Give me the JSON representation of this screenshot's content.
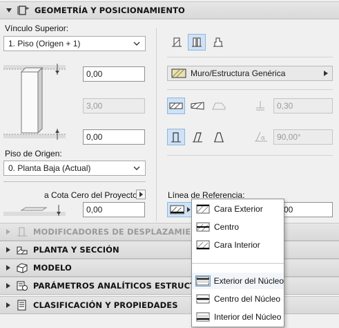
{
  "geometry": {
    "title": "GEOMETRÍA Y POSICIONAMIENTO",
    "top_link_label": "Vínculo Superior:",
    "top_link_value": "1. Piso (Origen + 1)",
    "top_offset": "0,00",
    "height": "3,00",
    "bottom_offset": "0,00",
    "origin_floor_label": "Piso de Origen:",
    "origin_floor_value": "0. Planta Baja (Actual)",
    "project_zero_label": "a Cota Cero del Proyecto",
    "project_zero_value": "0,00",
    "material_value": "Muro/Estructura Genérica",
    "thickness": "0,30",
    "angle": "90,00°",
    "reference_line_label": "Línea de Referencia:",
    "reference_offset_partial": "00"
  },
  "sections": [
    {
      "title": "MODIFICADORES DE DESPLAZAMIENTO DE",
      "icon": "offset-modifier-icon",
      "dimmed": true
    },
    {
      "title": "PLANTA Y SECCIÓN",
      "icon": "floor-plan-section-icon"
    },
    {
      "title": "MODELO",
      "icon": "model-cube-icon"
    },
    {
      "title": "PARÁMETROS ANALÍTICOS ESTRUCTURALES",
      "icon": "structural-analytics-icon"
    },
    {
      "title": "CLASIFICACIÓN Y PROPIEDADES",
      "icon": "classification-icon"
    }
  ],
  "reference_menu": {
    "items": [
      "Cara Exterior",
      "Centro",
      "Cara Interior",
      "Exterior del Núcleo",
      "Centro del Núcleo",
      "Interior del Núcleo"
    ]
  },
  "colors": {
    "active_button": "#cfe2f6",
    "header_bg": "#dedede"
  }
}
